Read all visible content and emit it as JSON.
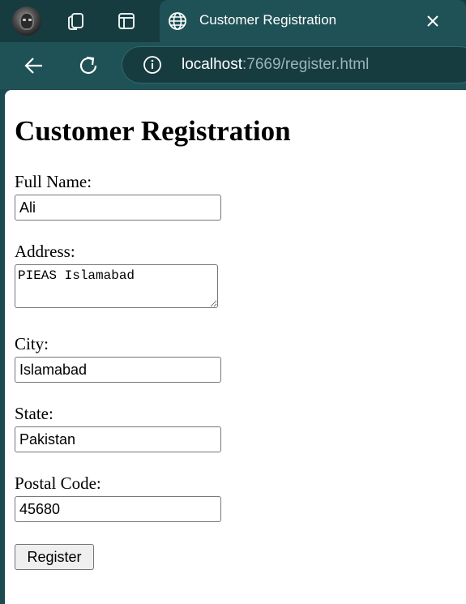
{
  "browser": {
    "tab_title": "Customer Registration",
    "url_host": "localhost",
    "url_rest": ":7669/register.html",
    "colors": {
      "tabbar_bg": "#163c40",
      "toolbar_bg": "#1f5257",
      "url_muted": "#9bb5b7"
    }
  },
  "page": {
    "heading": "Customer Registration",
    "fields": {
      "full_name": {
        "label": "Full Name:",
        "value": "Ali"
      },
      "address": {
        "label": "Address:",
        "value": "PIEAS Islamabad"
      },
      "city": {
        "label": "City:",
        "value": "Islamabad"
      },
      "state": {
        "label": "State:",
        "value": "Pakistan"
      },
      "postal_code": {
        "label": "Postal Code:",
        "value": "45680"
      }
    },
    "submit_label": "Register"
  }
}
